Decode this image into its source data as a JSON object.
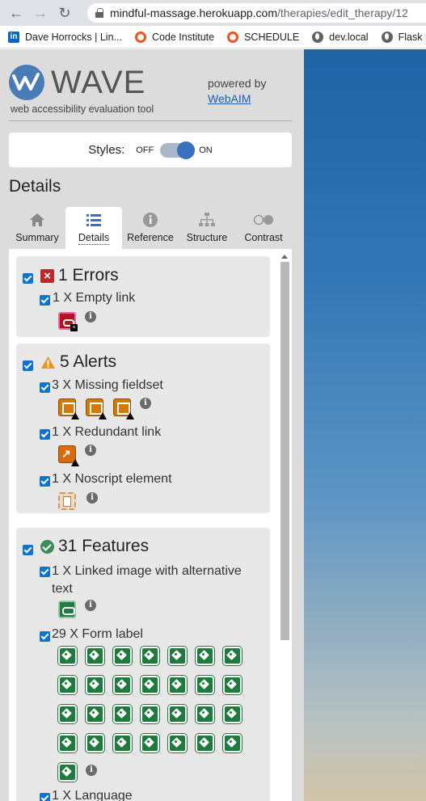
{
  "browser": {
    "url_host": "mindful-massage.herokuapp.com",
    "url_path": "/therapies/edit_therapy/12",
    "bookmarks": [
      {
        "label": "Dave Horrocks | Lin...",
        "icon": "linkedin-icon"
      },
      {
        "label": "Code Institute",
        "icon": "ring-icon"
      },
      {
        "label": "SCHEDULE",
        "icon": "ring-icon"
      },
      {
        "label": "dev.local",
        "icon": "globe-icon"
      },
      {
        "label": "Flask Lo",
        "icon": "globe-icon"
      }
    ]
  },
  "wave": {
    "logo_text": "WAVE",
    "tagline": "web accessibility evaluation tool",
    "powered_by": "powered by",
    "webaim_link": "WebAIM",
    "styles_label": "Styles:",
    "styles_off": "OFF",
    "styles_on": "ON",
    "styles_state": "on",
    "details_title": "Details",
    "tabs": [
      {
        "label": "Summary",
        "icon": "home-icon",
        "active": false
      },
      {
        "label": "Details",
        "icon": "list-icon",
        "active": true
      },
      {
        "label": "Reference",
        "icon": "info-icon",
        "active": false
      },
      {
        "label": "Structure",
        "icon": "sitemap-icon",
        "active": false
      },
      {
        "label": "Contrast",
        "icon": "contrast-icon",
        "active": false
      }
    ],
    "errors": {
      "heading": "1 Errors",
      "items": [
        {
          "label": "1 X Empty link",
          "icon": "empty-link-icon"
        }
      ]
    },
    "alerts": {
      "heading": "5 Alerts",
      "items": [
        {
          "label": "3 X Missing fieldset",
          "icon": "missing-fieldset-icon",
          "count": 3
        },
        {
          "label": "1 X Redundant link",
          "icon": "redundant-link-icon",
          "count": 1
        },
        {
          "label": "1 X Noscript element",
          "icon": "noscript-icon",
          "count": 1
        }
      ]
    },
    "features": {
      "heading": "31 Features",
      "items": [
        {
          "label": "1 X Linked image with alternative text",
          "icon": "linked-image-icon",
          "count": 1
        },
        {
          "label": "29 X Form label",
          "icon": "form-label-icon",
          "count": 29
        },
        {
          "label": "1 X Language",
          "icon": "language-icon",
          "count": 1
        }
      ]
    },
    "colors": {
      "error": "#c0272d",
      "alert": "#e8971d",
      "feature": "#3d8c59",
      "checkbox": "#0a73d9"
    }
  }
}
